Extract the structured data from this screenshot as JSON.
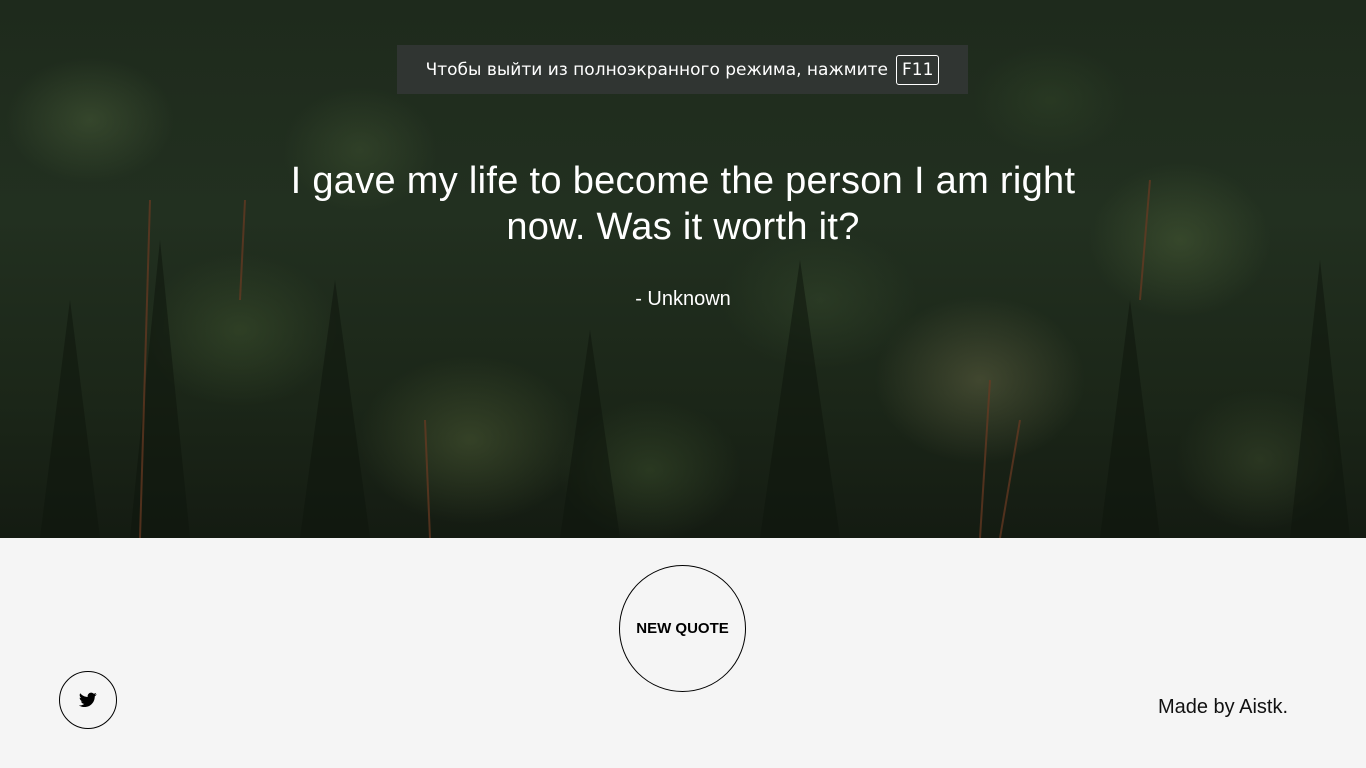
{
  "fullscreen_notice": {
    "message": "Чтобы выйти из полноэкранного режима, нажмите",
    "key": "F11"
  },
  "quote": {
    "text": "I gave my life to become the person I am right now. Was it worth it?",
    "author": "- Unknown"
  },
  "buttons": {
    "new_quote": "NEW QUOTE",
    "tweet_icon": "twitter-bird-icon"
  },
  "footer": {
    "credit": "Made by Aistk."
  },
  "colors": {
    "footer_bg": "#f5f5f5",
    "text_light": "#ffffff",
    "text_dark": "#000000"
  }
}
